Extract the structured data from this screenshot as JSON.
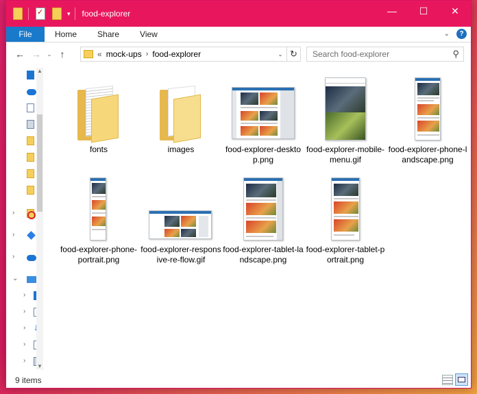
{
  "window": {
    "title": "food-explorer",
    "controls": {
      "minimize": "—",
      "maximize": "☐",
      "close": "✕"
    }
  },
  "ribbon": {
    "tabs": [
      "File",
      "Home",
      "Share",
      "View"
    ]
  },
  "navigation": {
    "back": "←",
    "forward": "→",
    "recent": "⌄",
    "up": "↑",
    "breadcrumb": [
      "«",
      "mock-ups",
      "food-explorer"
    ],
    "refresh": "↻",
    "search_placeholder": "Search food-explorer",
    "search_icon": "search-icon"
  },
  "files": [
    {
      "name": "fonts",
      "kind": "folder"
    },
    {
      "name": "images",
      "kind": "folder"
    },
    {
      "name": "food-explorer-desktop.png",
      "kind": "image"
    },
    {
      "name": "food-explorer-mobile-menu.gif",
      "kind": "image"
    },
    {
      "name": "food-explorer-phone-landscape.png",
      "kind": "image"
    },
    {
      "name": "food-explorer-phone-portrait.png",
      "kind": "image"
    },
    {
      "name": "food-explorer-responsive-re-flow.gif",
      "kind": "image"
    },
    {
      "name": "food-explorer-tablet-landscape.png",
      "kind": "image"
    },
    {
      "name": "food-explorer-tablet-portrait.png",
      "kind": "image"
    }
  ],
  "status": {
    "item_count": "9 items"
  },
  "colors": {
    "titlebar": "#e8175d",
    "file_tab": "#1979ca"
  }
}
